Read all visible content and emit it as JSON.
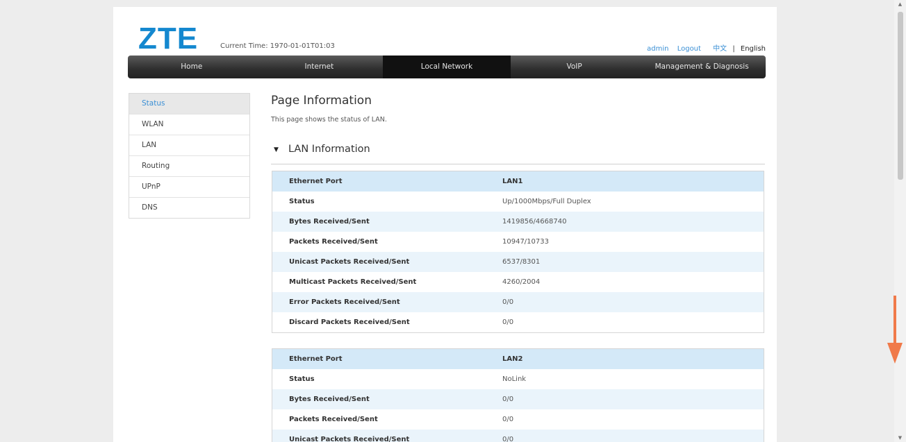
{
  "header": {
    "logo": "ZTE",
    "current_time": "Current Time: 1970-01-01T01:03",
    "user": "admin",
    "logout": "Logout",
    "lang_zh": "中文",
    "lang_sep": "|",
    "lang_en": "English"
  },
  "nav": {
    "items": [
      "Home",
      "Internet",
      "Local Network",
      "VoIP",
      "Management & Diagnosis"
    ],
    "active": "Local Network"
  },
  "sidebar": {
    "items": [
      "Status",
      "WLAN",
      "LAN",
      "Routing",
      "UPnP",
      "DNS"
    ],
    "active": "Status"
  },
  "main": {
    "title": "Page Information",
    "description": "This page shows the status of LAN.",
    "section_title": "LAN Information"
  },
  "lan_tables": [
    {
      "rows": [
        {
          "label": "Ethernet Port",
          "value": "LAN1"
        },
        {
          "label": "Status",
          "value": "Up/1000Mbps/Full Duplex"
        },
        {
          "label": "Bytes Received/Sent",
          "value": "1419856/4668740"
        },
        {
          "label": "Packets Received/Sent",
          "value": "10947/10733"
        },
        {
          "label": "Unicast Packets Received/Sent",
          "value": "6537/8301"
        },
        {
          "label": "Multicast Packets Received/Sent",
          "value": "4260/2004"
        },
        {
          "label": "Error Packets Received/Sent",
          "value": "0/0"
        },
        {
          "label": "Discard Packets Received/Sent",
          "value": "0/0"
        }
      ]
    },
    {
      "rows": [
        {
          "label": "Ethernet Port",
          "value": "LAN2"
        },
        {
          "label": "Status",
          "value": "NoLink"
        },
        {
          "label": "Bytes Received/Sent",
          "value": "0/0"
        },
        {
          "label": "Packets Received/Sent",
          "value": "0/0"
        },
        {
          "label": "Unicast Packets Received/Sent",
          "value": "0/0"
        }
      ]
    }
  ],
  "colors": {
    "brand": "#1488cf",
    "link": "#3a8fd5",
    "table_header": "#d4e9f8",
    "table_zebra": "#eaf4fb",
    "annotation_arrow": "#f07a4a"
  },
  "icons": {
    "section_toggle": "triangle-down-icon",
    "scroll_up": "scroll-up-icon",
    "scroll_down": "scroll-down-icon",
    "overlay": "down-arrow-icon"
  }
}
